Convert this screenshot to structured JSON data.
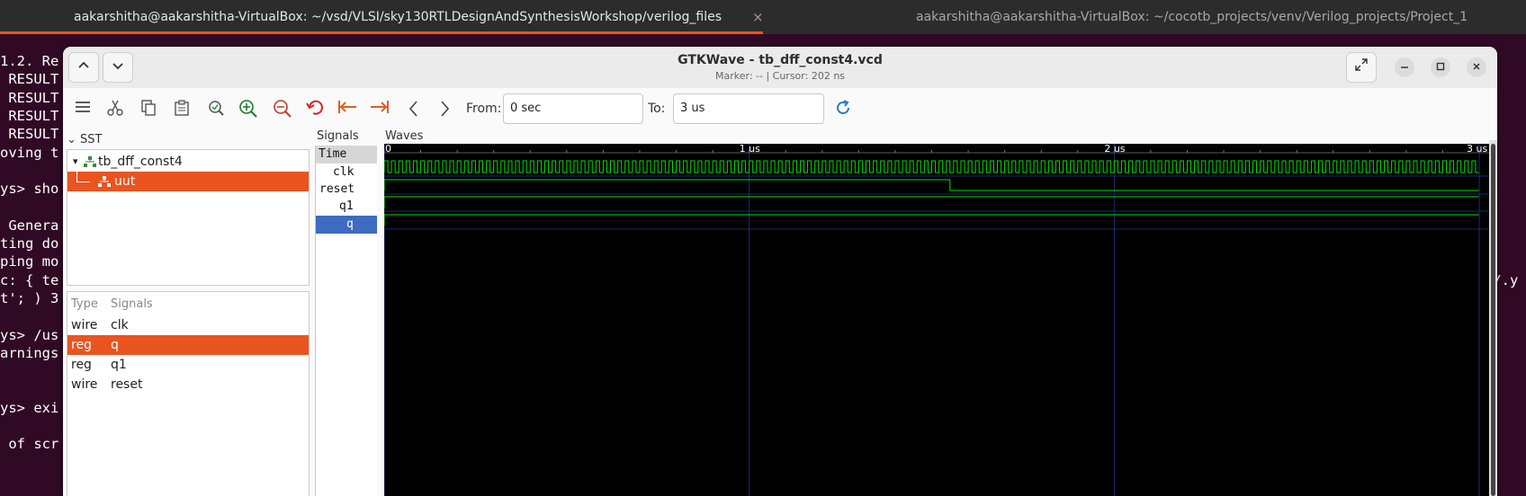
{
  "terminal": {
    "tab_active": "aakarshitha@aakarshitha-VirtualBox: ~/vsd/VLSI/sky130RTLDesignAndSynthesisWorkshop/verilog_files",
    "tab_inactive": "aakarshitha@aakarshitha-VirtualBox: ~/cocotb_projects/venv/Verilog_projects/Project_1",
    "close_glyph": "×",
    "lines": [
      "1.2. Re",
      " RESULT",
      " RESULT",
      " RESULT",
      " RESULT",
      "oving t",
      "",
      "ys> sho",
      "",
      " Genera",
      "ting do",
      "ping mo",
      "c: { te",
      "t'; ) 3",
      "",
      "ys> /us",
      "arnings",
      "",
      "",
      "ys> exi",
      "",
      " of scr"
    ],
    "right_fragment": "a/.y"
  },
  "window": {
    "title": "GTKWave - tb_dff_const4.vcd",
    "subtitle": "Marker: --  |  Cursor: 202 ns"
  },
  "toolbar": {
    "from_label": "From:",
    "from_value": "0 sec",
    "to_label": "To:",
    "to_value": "3 us"
  },
  "sst": {
    "label": "SST",
    "tree": [
      {
        "name": "tb_dff_const4",
        "selected": false
      },
      {
        "name": "uut",
        "selected": true
      }
    ]
  },
  "signals_table": {
    "header_type": "Type",
    "header_signals": "Signals",
    "rows": [
      {
        "type": "wire",
        "name": "clk",
        "selected": false
      },
      {
        "type": "reg",
        "name": "q",
        "selected": true
      },
      {
        "type": "reg",
        "name": "q1",
        "selected": false
      },
      {
        "type": "wire",
        "name": "reset",
        "selected": false
      }
    ]
  },
  "signals_pane": {
    "label": "Signals",
    "time_header": "Time",
    "names": [
      "clk",
      "reset",
      "q1",
      "q"
    ]
  },
  "waves": {
    "label": "Waves",
    "time_labels": [
      "0",
      "1 us",
      "2 us",
      "3 us"
    ],
    "time_range_us": [
      0,
      3
    ],
    "clk_cycles": 150,
    "reset_high_until_us": 1.55,
    "q1_value": 1,
    "q_value": 1,
    "wave_color": "#00e000"
  },
  "colors": {
    "accent": "#e95420",
    "selection_blue": "#3d6cc0",
    "terminal_bg": "#300a24"
  }
}
